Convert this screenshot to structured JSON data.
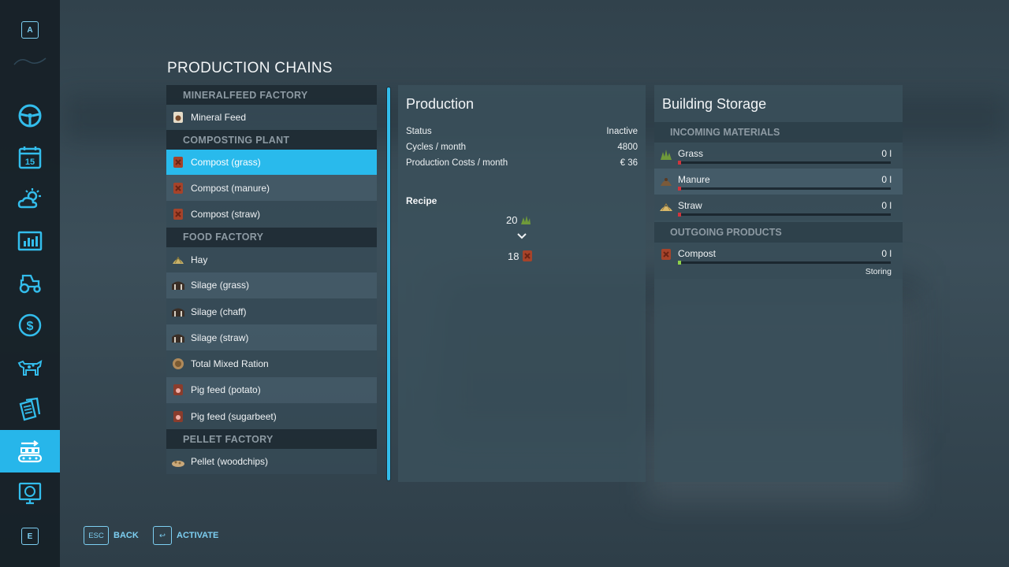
{
  "sidebar": {
    "top_key": "A",
    "bottom_key": "E",
    "items": [
      {
        "icon": "steering-wheel-icon"
      },
      {
        "icon": "calendar-icon",
        "text": "15"
      },
      {
        "icon": "weather-icon"
      },
      {
        "icon": "statistics-icon"
      },
      {
        "icon": "tractor-icon"
      },
      {
        "icon": "finance-icon"
      },
      {
        "icon": "animals-icon"
      },
      {
        "icon": "contracts-icon"
      },
      {
        "icon": "production-icon",
        "active": true
      },
      {
        "icon": "help-icon"
      }
    ],
    "accent": "#27b6ea"
  },
  "page_title": "PRODUCTION CHAINS",
  "list": {
    "sections": [
      {
        "header": "MINERALFEED FACTORY",
        "items": [
          {
            "label": "Mineral Feed",
            "icon": "mineral-feed-icon"
          }
        ]
      },
      {
        "header": "COMPOSTING PLANT",
        "items": [
          {
            "label": "Compost (grass)",
            "icon": "compost-icon",
            "selected": true
          },
          {
            "label": "Compost (manure)",
            "icon": "compost-icon"
          },
          {
            "label": "Compost (straw)",
            "icon": "compost-icon"
          }
        ]
      },
      {
        "header": "FOOD FACTORY",
        "items": [
          {
            "label": "Hay",
            "icon": "hay-icon"
          },
          {
            "label": "Silage (grass)",
            "icon": "silage-icon"
          },
          {
            "label": "Silage (chaff)",
            "icon": "silage-icon"
          },
          {
            "label": "Silage (straw)",
            "icon": "silage-icon"
          },
          {
            "label": "Total Mixed Ration",
            "icon": "mixed-ration-icon"
          },
          {
            "label": "Pig feed (potato)",
            "icon": "pig-feed-icon"
          },
          {
            "label": "Pig feed (sugarbeet)",
            "icon": "pig-feed-icon"
          }
        ]
      },
      {
        "header": "PELLET FACTORY",
        "items": [
          {
            "label": "Pellet (woodchips)",
            "icon": "pellet-icon"
          }
        ]
      }
    ]
  },
  "production": {
    "title": "Production",
    "rows": [
      {
        "label": "Status",
        "value": "Inactive"
      },
      {
        "label": "Cycles / month",
        "value": "4800"
      },
      {
        "label": "Production Costs / month",
        "value": "€ 36"
      }
    ],
    "recipe_label": "Recipe",
    "recipe_input": {
      "amount": "20",
      "icon": "grass-icon"
    },
    "recipe_output": {
      "amount": "18",
      "icon": "compost-icon"
    }
  },
  "storage": {
    "title": "Building Storage",
    "incoming_header": "INCOMING MATERIALS",
    "incoming": [
      {
        "name": "Grass",
        "amount": "0 l",
        "icon": "grass-icon",
        "fill": 0,
        "tip_color": "#d0343c"
      },
      {
        "name": "Manure",
        "amount": "0 l",
        "icon": "manure-icon",
        "fill": 0,
        "tip_color": "#d0343c"
      },
      {
        "name": "Straw",
        "amount": "0 l",
        "icon": "straw-icon",
        "fill": 0,
        "tip_color": "#d0343c"
      }
    ],
    "outgoing_header": "OUTGOING PRODUCTS",
    "outgoing": [
      {
        "name": "Compost",
        "amount": "0 l",
        "icon": "compost-icon",
        "fill": 0,
        "tip_color": "#8fd14a",
        "state": "Storing"
      }
    ]
  },
  "footer": {
    "back_key": "ESC",
    "back_label": "BACK",
    "activate_key": "↩",
    "activate_label": "ACTIVATE"
  }
}
